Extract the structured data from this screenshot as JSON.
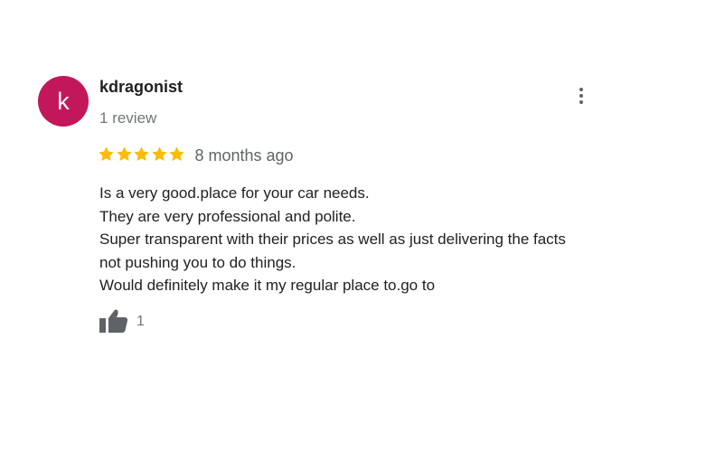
{
  "review": {
    "avatar_letter": "k",
    "avatar_color": "#c2185b",
    "author_name": "kdragonist",
    "author_review_count": "1 review",
    "rating": 5,
    "rating_max": 5,
    "star_color": "#fbbc04",
    "time_ago": "8 months ago",
    "text_lines": [
      "Is a very good.place for your car needs.",
      "They are very professional and polite.",
      "Super transparent with their prices as well as just delivering the facts",
      "not pushing you to do things.",
      "Would definitely make it my regular place to.go to"
    ],
    "like_count": "1",
    "icons": {
      "more": "more-vert-icon",
      "like": "thumb-up-icon",
      "star": "star-icon"
    }
  }
}
